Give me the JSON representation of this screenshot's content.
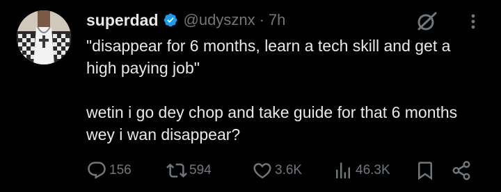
{
  "tweet": {
    "display_name": "superdad",
    "handle": "@udysznx",
    "separator": "·",
    "time": "7h",
    "verified_icon": "verified-badge-icon",
    "verified_color": "#1d9bf0",
    "text_lines": [
      "\"disappear for 6 months, learn a tech skill and get a high paying job\"",
      "wetin i go dey chop and take guide for that 6 months wey i wan disappear?"
    ]
  },
  "actions": {
    "reply_count": "156",
    "retweet_count": "594",
    "like_count": "3.6K",
    "views_count": "46.3K"
  },
  "icons": {
    "grok": "grok-icon",
    "more": "more-dots-icon",
    "reply": "reply-icon",
    "retweet": "retweet-icon",
    "like": "heart-icon",
    "views": "views-bar-chart-icon",
    "bookmark": "bookmark-icon",
    "share": "share-icon"
  },
  "colors": {
    "background": "#000000",
    "primary_text": "#e7e9ea",
    "secondary_text": "#71767b"
  }
}
